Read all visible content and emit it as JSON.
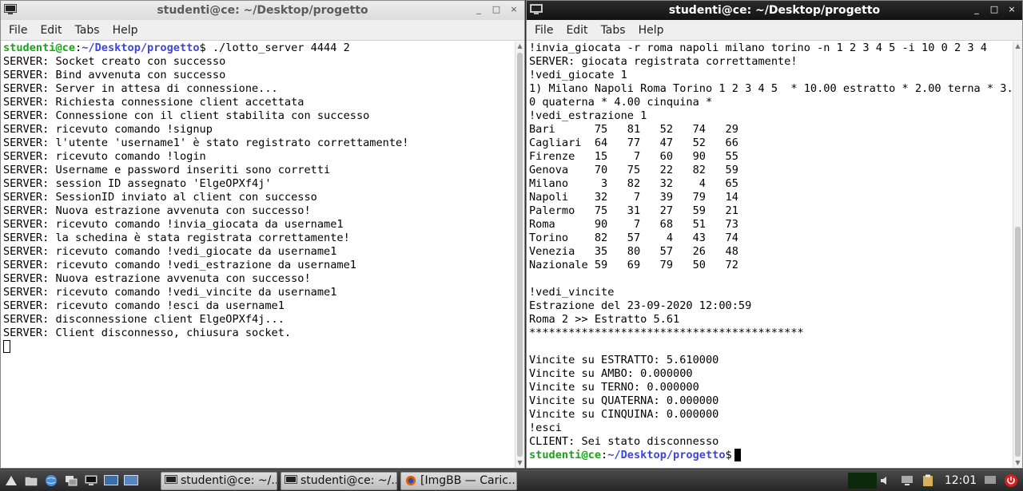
{
  "left_window": {
    "title": "studenti@ce: ~/Desktop/progetto",
    "controls": [
      "_",
      "□",
      "×"
    ],
    "menu": [
      "File",
      "Edit",
      "Tabs",
      "Help"
    ],
    "prompt": {
      "user": "studenti@ce",
      "sep": ":",
      "path": "~/Desktop/progetto",
      "symbol": "$",
      "command": " ./lotto_server 4444 2"
    },
    "lines": [
      "SERVER: Socket creato con successo",
      "SERVER: Bind avvenuta con successo",
      "SERVER: Server in attesa di connessione...",
      "SERVER: Richiesta connessione client accettata",
      "SERVER: Connessione con il client stabilita con successo",
      "SERVER: ricevuto comando !signup",
      "SERVER: l'utente 'username1' è stato registrato correttamente!",
      "SERVER: ricevuto comando !login",
      "SERVER: Username e password inseriti sono corretti",
      "SERVER: session ID assegnato 'ElgeOPXf4j'",
      "SERVER: SessionID inviato al client con successo",
      "SERVER: Nuova estrazione avvenuta con successo!",
      "SERVER: ricevuto comando !invia_giocata da username1",
      "SERVER: la schedina è stata registrata correttamente!",
      "SERVER: ricevuto comando !vedi_giocate da username1",
      "SERVER: ricevuto comando !vedi_estrazione da username1",
      "SERVER: Nuova estrazione avvenuta con successo!",
      "SERVER: ricevuto comando !vedi_vincite da username1",
      "SERVER: ricevuto comando !esci da username1",
      "SERVER: disconnessione client ElgeOPXf4j...",
      "SERVER: Client disconnesso, chiusura socket."
    ]
  },
  "right_window": {
    "title": "studenti@ce: ~/Desktop/progetto",
    "controls": [
      "_",
      "□",
      "×"
    ],
    "menu": [
      "File",
      "Edit",
      "Tabs",
      "Help"
    ],
    "lines": [
      "!invia_giocata -r roma napoli milano torino -n 1 2 3 4 5 -i 10 0 2 3 4",
      "SERVER: giocata registrata correttamente!",
      "!vedi_giocate 1",
      "1) Milano Napoli Roma Torino 1 2 3 4 5  * 10.00 estratto * 2.00 terna * 3.0",
      "0 quaterna * 4.00 cinquina *",
      "!vedi_estrazione 1",
      "Bari      75   81   52   74   29",
      "Cagliari  64   77   47   52   66",
      "Firenze   15    7   60   90   55",
      "Genova    70   75   22   82   59",
      "Milano     3   82   32    4   65",
      "Napoli    32    7   39   79   14",
      "Palermo   75   31   27   59   21",
      "Roma      90    7   68   51   73",
      "Torino    82   57    4   43   74",
      "Venezia   35   80   57   26   48",
      "Nazionale 59   69   79   50   72",
      "",
      "!vedi_vincite",
      "Estrazione del 23-09-2020 12:00:59",
      "Roma 2 >> Estratto 5.61",
      "******************************************",
      "",
      "Vincite su ESTRATTO: 5.610000",
      "Vincite su AMBO: 0.000000",
      "Vincite su TERNO: 0.000000",
      "Vincite su QUATERNA: 0.000000",
      "Vincite su CINQUINA: 0.000000",
      "!esci",
      "CLIENT: Sei stato disconnesso"
    ],
    "prompt": {
      "user": "studenti@ce",
      "sep": ":",
      "path": "~/Desktop/progetto",
      "symbol": "$"
    }
  },
  "taskbar": {
    "tasks": [
      {
        "label": "studenti@ce: ~/...",
        "icon": "terminal-icon"
      },
      {
        "label": "studenti@ce: ~/...",
        "icon": "terminal-icon"
      },
      {
        "label": "[ImgBB — Caric...",
        "icon": "firefox-icon"
      }
    ],
    "clock": "12:01",
    "colors": {
      "bar": "#262626",
      "net_graph": "#0b2a0b",
      "prompt_user": "#1aa31a",
      "prompt_path": "#3f46d8",
      "power": "#d42020"
    }
  }
}
